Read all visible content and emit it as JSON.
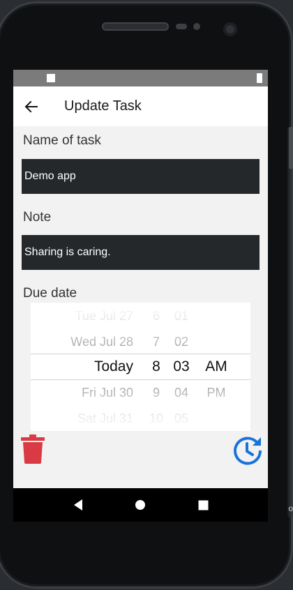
{
  "app_bar": {
    "title": "Update Task",
    "back_icon": "arrow-back-icon"
  },
  "form": {
    "name_label": "Name of task",
    "name_value": "Demo app",
    "note_label": "Note",
    "note_value": "Sharing is caring.",
    "due_label": "Due date"
  },
  "picker": {
    "days": [
      "Tue Jul 27",
      "Wed Jul 28",
      "Today",
      "Fri Jul 30",
      "Sat Jul 31"
    ],
    "hours": [
      "6",
      "7",
      "8",
      "9",
      "10"
    ],
    "minutes": [
      "01",
      "02",
      "03",
      "04",
      "05"
    ],
    "ampm": [
      "AM",
      "PM"
    ],
    "selected": {
      "day": "Today",
      "hour": "8",
      "minute": "03",
      "ampm": "AM"
    }
  },
  "actions": {
    "delete_icon": "trash-icon",
    "update_time_icon": "update-clock-icon"
  },
  "colors": {
    "accent_blue": "#1a73d9",
    "delete_red": "#d93a44",
    "input_bg": "#25282b"
  },
  "edge_text": "o"
}
